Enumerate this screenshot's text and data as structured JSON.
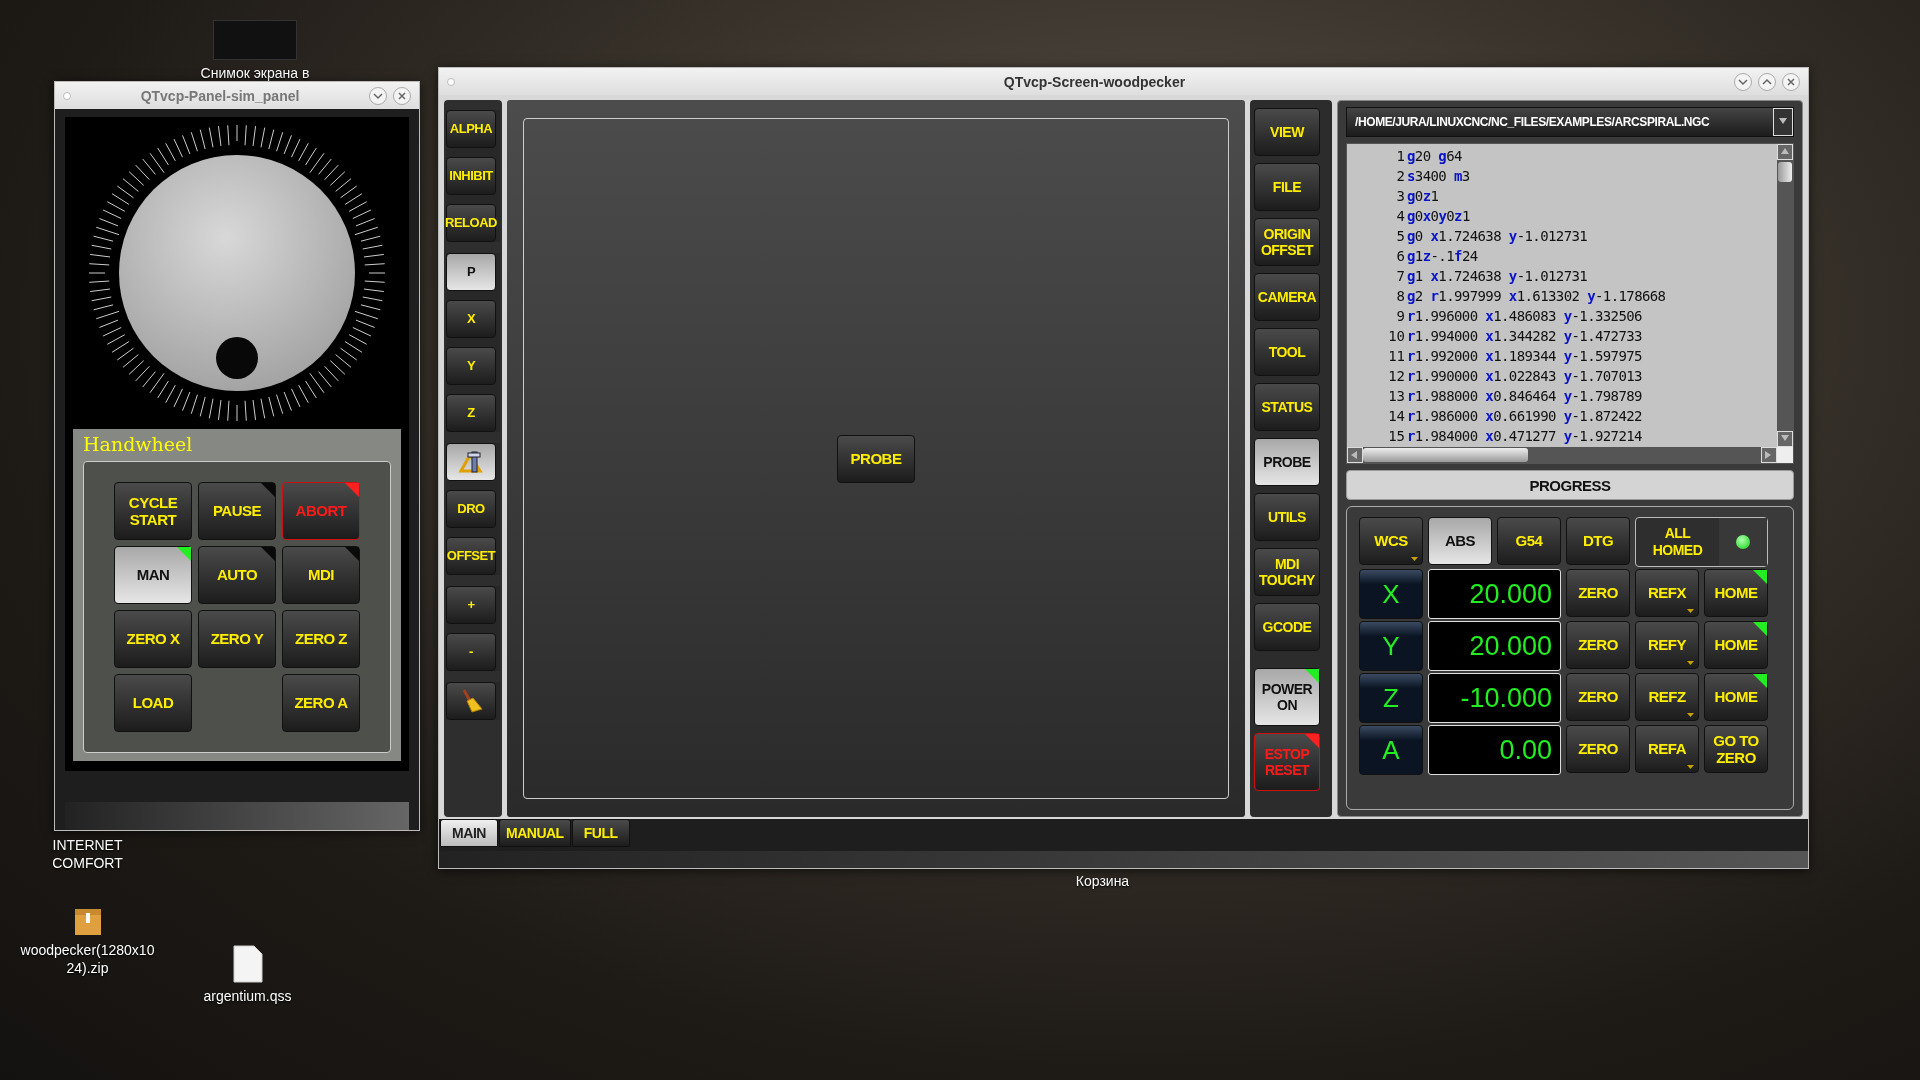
{
  "desktop": {
    "icons": [
      {
        "label": "Снимок экрана в",
        "kind": "image"
      },
      {
        "label": "INTERNET COMFORT",
        "kind": "link"
      },
      {
        "label": "woodpecker(1280x1024).zip",
        "kind": "archive"
      },
      {
        "label": "argentium.qss",
        "kind": "document"
      }
    ],
    "trash_label": "Корзина"
  },
  "sim_panel": {
    "title": "QTvcp-Panel-sim_panel",
    "group_title": "Handwheel",
    "rows": [
      [
        {
          "label": "CYCLE START",
          "selected": false,
          "alarm": false
        },
        {
          "label": "PAUSE",
          "selected": false,
          "alarm": false,
          "color": "#0a0a0a"
        },
        {
          "label": "ABORT",
          "selected": false,
          "alarm": true,
          "color": "#ff2020"
        }
      ],
      [
        {
          "label": "MAN",
          "selected": true,
          "alarm": false,
          "color": "#22ee22"
        },
        {
          "label": "AUTO",
          "selected": false,
          "alarm": false,
          "color": "#0a0a0a"
        },
        {
          "label": "MDI",
          "selected": false,
          "alarm": false,
          "color": "#0a0a0a"
        }
      ],
      [
        {
          "label": "ZERO X",
          "selected": false,
          "alarm": false
        },
        {
          "label": "ZERO Y",
          "selected": false,
          "alarm": false
        },
        {
          "label": "ZERO Z",
          "selected": false,
          "alarm": false
        }
      ],
      [
        {
          "label": "LOAD",
          "selected": false,
          "alarm": false
        },
        null,
        {
          "label": "ZERO A",
          "selected": false,
          "alarm": false
        }
      ]
    ]
  },
  "main_window": {
    "title": "QTvcp-Screen-woodpecker",
    "left_toolbar": [
      {
        "buttons": [
          {
            "kind": "text",
            "label": "ALPHA",
            "selected": false
          },
          {
            "kind": "text",
            "label": "INHIBIT",
            "selected": false
          },
          {
            "kind": "text",
            "label": "RELOAD",
            "selected": false
          }
        ]
      },
      {
        "buttons": [
          {
            "kind": "text",
            "label": "P",
            "selected": true
          },
          {
            "kind": "text",
            "label": "X",
            "selected": false
          },
          {
            "kind": "text",
            "label": "Y",
            "selected": false
          },
          {
            "kind": "text",
            "label": "Z",
            "selected": false
          }
        ]
      },
      {
        "buttons": [
          {
            "kind": "measure",
            "selected": true
          },
          {
            "kind": "text",
            "label": "DRO",
            "selected": false
          },
          {
            "kind": "text",
            "label": "OFFSET",
            "selected": false
          }
        ]
      },
      {
        "buttons": [
          {
            "kind": "text",
            "label": "+",
            "selected": false
          },
          {
            "kind": "text",
            "label": "-",
            "selected": false
          }
        ]
      },
      {
        "buttons": [
          {
            "kind": "clear",
            "selected": false
          }
        ]
      }
    ],
    "center": {
      "probe_button": "PROBE"
    },
    "right_toolbar": [
      {
        "label": "VIEW",
        "selected": false,
        "alarm": false
      },
      {
        "label": "FILE",
        "selected": false,
        "alarm": false
      },
      {
        "label": "ORIGIN OFFSET",
        "selected": false,
        "alarm": false
      },
      {
        "label": "CAMERA",
        "selected": false,
        "alarm": false
      },
      {
        "label": "TOOL",
        "selected": false,
        "alarm": false
      },
      {
        "label": "STATUS",
        "selected": false,
        "alarm": false
      },
      {
        "label": "PROBE",
        "selected": true,
        "alarm": false
      },
      {
        "label": "UTILS",
        "selected": false,
        "alarm": false
      },
      {
        "label": "MDI TOUCHY",
        "selected": false,
        "alarm": false
      },
      {
        "label": "GCODE",
        "selected": false,
        "alarm": false
      },
      {
        "label": "POWER ON",
        "selected": true,
        "alarm": false,
        "color": "#22ee22"
      },
      {
        "label": "ESTOP RESET",
        "selected": false,
        "alarm": true,
        "color": "#ff2020"
      }
    ],
    "gcode": {
      "file": "/HOME/JURA/LINUXCNC/NC_FILES/EXAMPLES/ARCSPIRAL.NGC",
      "lines": [
        {
          "number": "1",
          "code": "g20 g64"
        },
        {
          "number": "2",
          "code": "s3400 m3"
        },
        {
          "number": "3",
          "code": "g0z1"
        },
        {
          "number": "4",
          "code": "g0x0y0z1"
        },
        {
          "number": "5",
          "code": "g0 x1.724638 y-1.012731"
        },
        {
          "number": "6",
          "code": "g1z-.1f24"
        },
        {
          "number": "7",
          "code": "g1 x1.724638 y-1.012731"
        },
        {
          "number": "8",
          "code": "g2 r1.997999 x1.613302 y-1.178668"
        },
        {
          "number": "9",
          "code": "r1.996000 x1.486083 y-1.332506"
        },
        {
          "number": "10",
          "code": "r1.994000 x1.344282 y-1.472733"
        },
        {
          "number": "11",
          "code": "r1.992000 x1.189344 y-1.597975"
        },
        {
          "number": "12",
          "code": "r1.990000 x1.022843 y-1.707013"
        },
        {
          "number": "13",
          "code": "r1.988000 x0.846464 y-1.798789"
        },
        {
          "number": "14",
          "code": "r1.986000 x0.661990 y-1.872422"
        },
        {
          "number": "15",
          "code": "r1.984000 x0.471277 y-1.927214"
        }
      ]
    },
    "progress": {
      "label": "PROGRESS"
    },
    "dro": {
      "header": [
        {
          "label": "WCS",
          "selected": false,
          "dropdown": true
        },
        {
          "label": "ABS",
          "selected": true,
          "dropdown": false
        },
        {
          "label": "G54",
          "selected": false,
          "dropdown": false
        },
        {
          "label": "DTG",
          "selected": false,
          "dropdown": false
        }
      ],
      "all_homed": {
        "label": "ALL HOMED",
        "on": true
      },
      "axes": [
        {
          "axis": "X",
          "value": "20.000",
          "zero": "ZERO",
          "ref": "REFX",
          "home": "HOME",
          "homed": true
        },
        {
          "axis": "Y",
          "value": "20.000",
          "zero": "ZERO",
          "ref": "REFY",
          "home": "HOME",
          "homed": true
        },
        {
          "axis": "Z",
          "value": "-10.000",
          "zero": "ZERO",
          "ref": "REFZ",
          "home": "HOME",
          "homed": true
        },
        {
          "axis": "A",
          "value": "0.00",
          "zero": "ZERO",
          "ref": "REFA",
          "home": "GO TO ZERO",
          "homed": false
        }
      ]
    },
    "tabs": [
      {
        "label": "MAIN",
        "selected": true
      },
      {
        "label": "MANUAL",
        "selected": false
      },
      {
        "label": "FULL",
        "selected": false
      }
    ]
  }
}
